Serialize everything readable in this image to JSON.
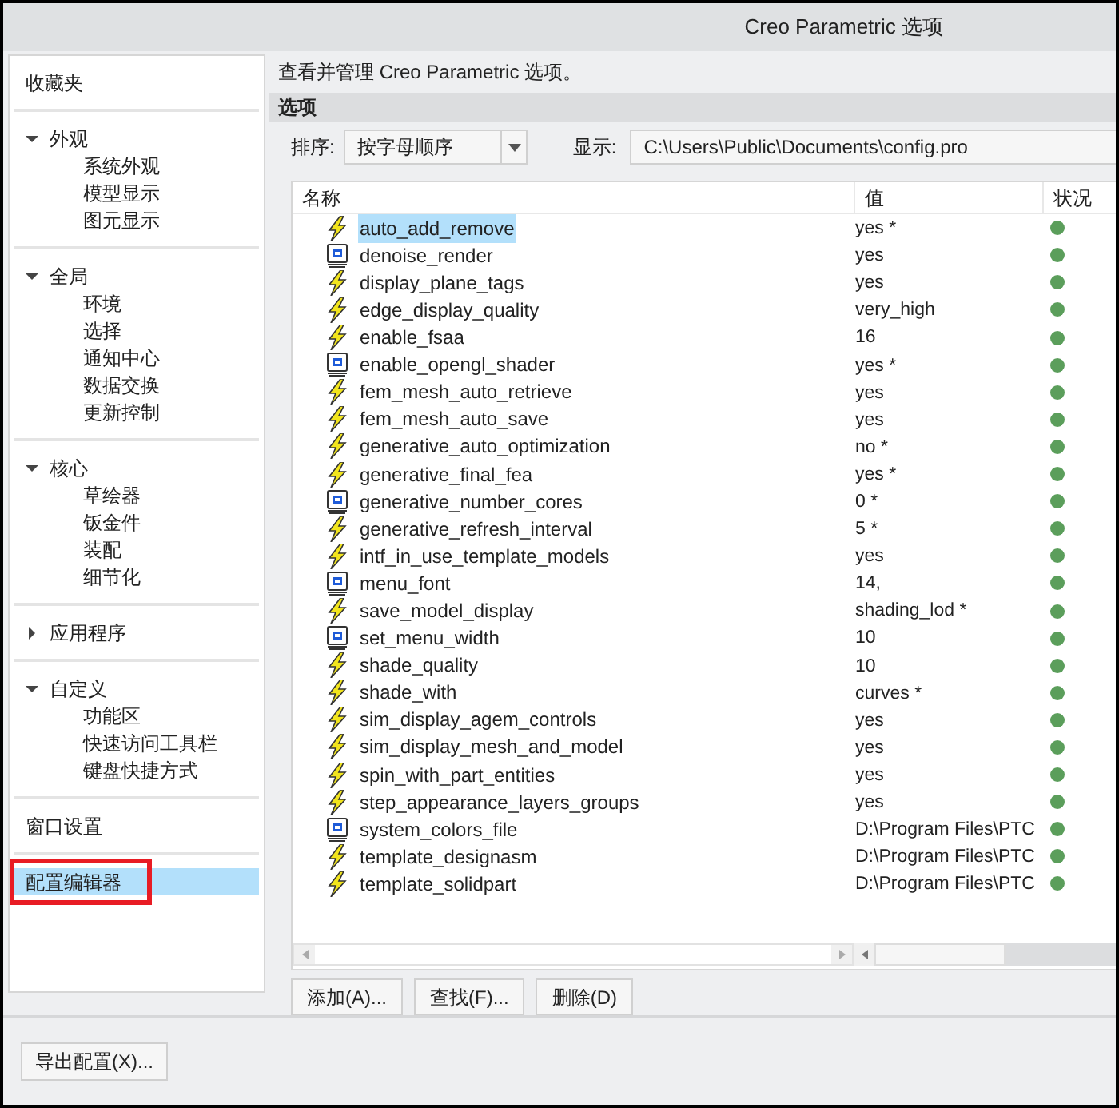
{
  "window": {
    "title": "Creo Parametric 选项"
  },
  "sidebar": {
    "items": [
      {
        "kind": "link",
        "label": "收藏夹",
        "selected": false,
        "highlighted": false
      },
      {
        "kind": "group",
        "label": "外观",
        "expanded": true,
        "children": [
          {
            "label": "系统外观"
          },
          {
            "label": "模型显示"
          },
          {
            "label": "图元显示"
          }
        ]
      },
      {
        "kind": "group",
        "label": "全局",
        "expanded": true,
        "children": [
          {
            "label": "环境"
          },
          {
            "label": "选择"
          },
          {
            "label": "通知中心"
          },
          {
            "label": "数据交换"
          },
          {
            "label": "更新控制"
          }
        ]
      },
      {
        "kind": "group",
        "label": "核心",
        "expanded": true,
        "children": [
          {
            "label": "草绘器"
          },
          {
            "label": "钣金件"
          },
          {
            "label": "装配"
          },
          {
            "label": "细节化"
          }
        ]
      },
      {
        "kind": "group",
        "label": "应用程序",
        "expanded": false
      },
      {
        "kind": "group",
        "label": "自定义",
        "expanded": true,
        "children": [
          {
            "label": "功能区"
          },
          {
            "label": "快速访问工具栏"
          },
          {
            "label": "键盘快捷方式"
          }
        ]
      },
      {
        "kind": "link",
        "label": "窗口设置",
        "selected": false,
        "highlighted": false
      },
      {
        "kind": "link",
        "label": "配置编辑器",
        "selected": true,
        "highlighted": true
      }
    ]
  },
  "description": "查看并管理 Creo Parametric 选项。",
  "section_title": "选项",
  "sort": {
    "label": "排序:",
    "value": "按字母顺序"
  },
  "display": {
    "label": "显示:",
    "value": "C:\\Users\\Public\\Documents\\config.pro"
  },
  "table": {
    "columns": [
      "名称",
      "值",
      "状况"
    ],
    "rows": [
      {
        "kind": "lightning",
        "name": "auto_add_remove",
        "value": "yes *",
        "selected": true,
        "color": "#5b9e5b"
      },
      {
        "kind": "monitor",
        "name": "denoise_render",
        "value": "yes",
        "selected": false,
        "color": "#5b9e5b"
      },
      {
        "kind": "lightning",
        "name": "display_plane_tags",
        "value": "yes",
        "selected": false,
        "color": "#5b9e5b"
      },
      {
        "kind": "lightning",
        "name": "edge_display_quality",
        "value": "very_high",
        "selected": false,
        "color": "#5b9e5b"
      },
      {
        "kind": "lightning",
        "name": "enable_fsaa",
        "value": "16",
        "selected": false,
        "color": "#5b9e5b"
      },
      {
        "kind": "monitor",
        "name": "enable_opengl_shader",
        "value": "yes *",
        "selected": false,
        "color": "#5b9e5b"
      },
      {
        "kind": "lightning",
        "name": "fem_mesh_auto_retrieve",
        "value": "yes",
        "selected": false,
        "color": "#5b9e5b"
      },
      {
        "kind": "lightning",
        "name": "fem_mesh_auto_save",
        "value": "yes",
        "selected": false,
        "color": "#5b9e5b"
      },
      {
        "kind": "lightning",
        "name": "generative_auto_optimization",
        "value": "no *",
        "selected": false,
        "color": "#5b9e5b"
      },
      {
        "kind": "lightning",
        "name": "generative_final_fea",
        "value": "yes *",
        "selected": false,
        "color": "#5b9e5b"
      },
      {
        "kind": "monitor",
        "name": "generative_number_cores",
        "value": "0 *",
        "selected": false,
        "color": "#5b9e5b"
      },
      {
        "kind": "lightning",
        "name": "generative_refresh_interval",
        "value": "5 *",
        "selected": false,
        "color": "#5b9e5b"
      },
      {
        "kind": "lightning",
        "name": "intf_in_use_template_models",
        "value": "yes",
        "selected": false,
        "color": "#5b9e5b"
      },
      {
        "kind": "monitor",
        "name": "menu_font",
        "value": "14,",
        "selected": false,
        "color": "#5b9e5b"
      },
      {
        "kind": "lightning",
        "name": "save_model_display",
        "value": "shading_lod *",
        "selected": false,
        "color": "#5b9e5b"
      },
      {
        "kind": "monitor",
        "name": "set_menu_width",
        "value": "10",
        "selected": false,
        "color": "#5b9e5b"
      },
      {
        "kind": "lightning",
        "name": "shade_quality",
        "value": "10",
        "selected": false,
        "color": "#5b9e5b"
      },
      {
        "kind": "lightning",
        "name": "shade_with",
        "value": "curves *",
        "selected": false,
        "color": "#5b9e5b"
      },
      {
        "kind": "lightning",
        "name": "sim_display_agem_controls",
        "value": "yes",
        "selected": false,
        "color": "#5b9e5b"
      },
      {
        "kind": "lightning",
        "name": "sim_display_mesh_and_model",
        "value": "yes",
        "selected": false,
        "color": "#5b9e5b"
      },
      {
        "kind": "lightning",
        "name": "spin_with_part_entities",
        "value": "yes",
        "selected": false,
        "color": "#5b9e5b"
      },
      {
        "kind": "lightning",
        "name": "step_appearance_layers_groups",
        "value": "yes",
        "selected": false,
        "color": "#5b9e5b"
      },
      {
        "kind": "monitor",
        "name": "system_colors_file",
        "value": "D:\\Program Files\\PTC",
        "selected": false,
        "color": "#5b9e5b"
      },
      {
        "kind": "lightning",
        "name": "template_designasm",
        "value": "D:\\Program Files\\PTC",
        "selected": false,
        "color": "#5b9e5b"
      },
      {
        "kind": "lightning",
        "name": "template_solidpart",
        "value": "D:\\Program Files\\PTC",
        "selected": false,
        "color": "#5b9e5b"
      }
    ]
  },
  "table_buttons": [
    "添加(A)...",
    "查找(F)...",
    "删除(D)"
  ],
  "footer_button": "导出配置(X)..."
}
